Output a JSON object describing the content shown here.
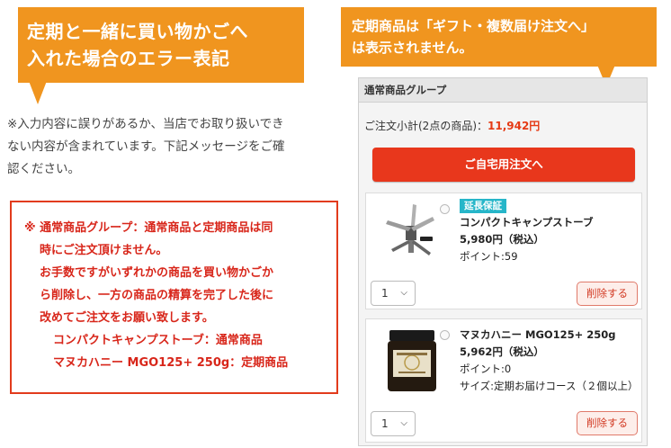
{
  "left_callout": {
    "line1": "定期と一緒に買い物かごへ",
    "line2": "入れた場合のエラー表記"
  },
  "notice": {
    "line1": "※入力内容に誤りがあるか、当店でお取り扱いでき",
    "line2": "ない内容が含まれています。下記メッセージをご確",
    "line3": "認ください。"
  },
  "error": {
    "line1": "※ 通常商品グループ：通常商品と定期商品は同",
    "line2": "時にご注文頂けません。",
    "line3": "お手数ですがいずれかの商品を買い物かごか",
    "line4": "ら削除し、一方の商品の精算を完了した後に",
    "line5": "改めてご注文をお願い致します。",
    "line6": "コンパクトキャンプストーブ：通常商品",
    "line7": "マヌカハニー MGO125+ 250g：定期商品"
  },
  "right_callout": {
    "line1": "定期商品は「ギフト・複数届け注文へ」",
    "line2": "は表示されません。"
  },
  "cart": {
    "header": "通常商品グループ",
    "subtotal_label": "ご注文小計(2点の商品)：",
    "subtotal_value": "11,942円",
    "order_button": "ご自宅用注文へ",
    "items": [
      {
        "badge": "延長保証",
        "name": "コンパクトキャンプストーブ",
        "price": "5,980円（税込）",
        "points": "ポイント:59",
        "qty": "1",
        "delete": "削除する"
      },
      {
        "name": "マヌカハニー MGO125+ 250g",
        "price": "5,962円（税込）",
        "points": "ポイント:0",
        "size": "サイズ:定期お届けコース（２個以上）",
        "qty": "1",
        "delete": "削除する"
      }
    ]
  },
  "colors": {
    "callout": "#f0951f",
    "error": "#d8261a",
    "order_button": "#e8371c",
    "badge": "#27b6c9"
  }
}
